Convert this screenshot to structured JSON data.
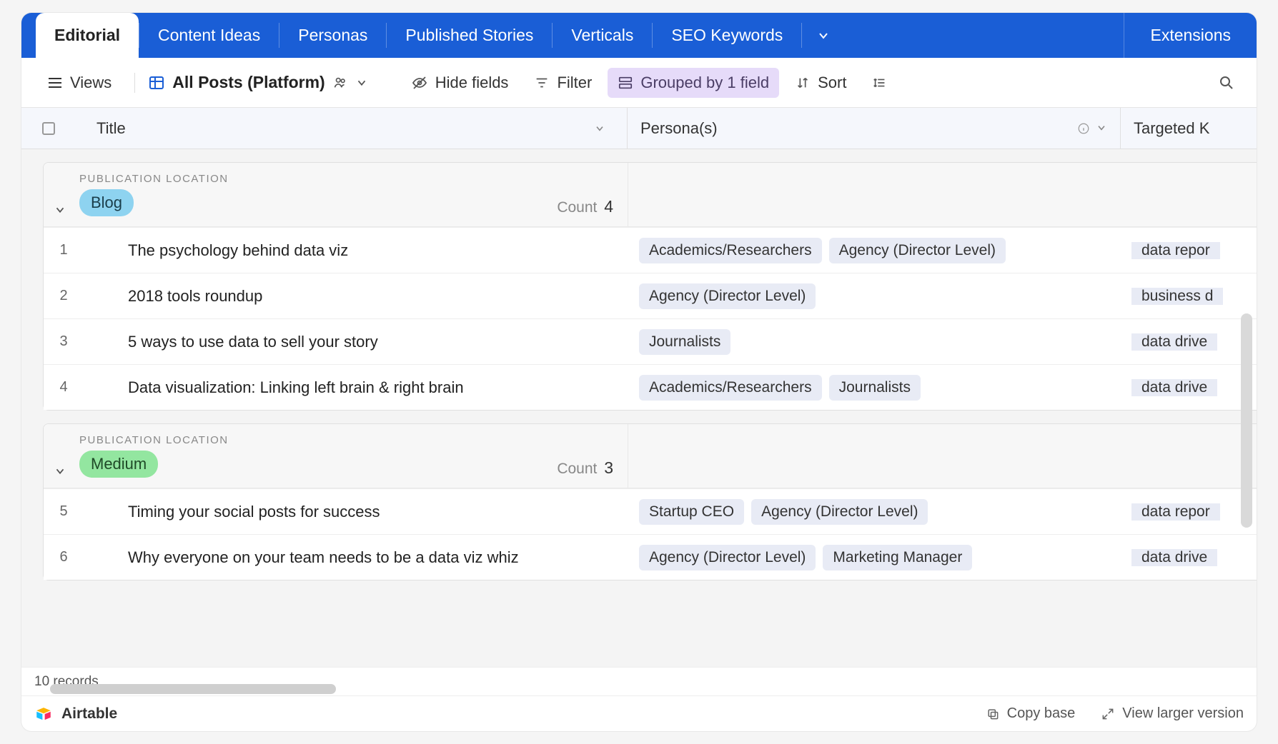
{
  "tabs": {
    "items": [
      "Editorial",
      "Content Ideas",
      "Personas",
      "Published Stories",
      "Verticals",
      "SEO Keywords"
    ],
    "active_index": 0,
    "extensions_label": "Extensions"
  },
  "toolbar": {
    "views_label": "Views",
    "view_name": "All Posts (Platform)",
    "hide_fields_label": "Hide fields",
    "filter_label": "Filter",
    "grouped_label": "Grouped by 1 field",
    "sort_label": "Sort"
  },
  "columns": {
    "title": "Title",
    "personas": "Persona(s)",
    "keywords": "Targeted K"
  },
  "group_label": "PUBLICATION LOCATION",
  "count_label": "Count",
  "groups": [
    {
      "name": "Blog",
      "pill_class": "pill-blog",
      "count": 4,
      "rows": [
        {
          "n": 1,
          "title": "The psychology behind data viz",
          "personas": [
            "Academics/Researchers",
            "Agency (Director Level)"
          ],
          "kw": "data repor"
        },
        {
          "n": 2,
          "title": "2018 tools roundup",
          "personas": [
            "Agency (Director Level)"
          ],
          "kw": "business d"
        },
        {
          "n": 3,
          "title": "5 ways to use data to sell your story",
          "personas": [
            "Journalists"
          ],
          "kw": "data drive"
        },
        {
          "n": 4,
          "title": "Data visualization: Linking left brain & right brain",
          "personas": [
            "Academics/Researchers",
            "Journalists"
          ],
          "kw": "data drive"
        }
      ]
    },
    {
      "name": "Medium",
      "pill_class": "pill-medium",
      "count": 3,
      "rows": [
        {
          "n": 5,
          "title": "Timing your social posts for success",
          "personas": [
            "Startup CEO",
            "Agency (Director Level)"
          ],
          "kw": "data repor"
        },
        {
          "n": 6,
          "title": "Why everyone on your team needs to be a data viz whiz",
          "personas": [
            "Agency (Director Level)",
            "Marketing Manager"
          ],
          "kw": "data drive"
        }
      ]
    }
  ],
  "footer": {
    "records_label": "10 records"
  },
  "brand": "Airtable",
  "bottom": {
    "copy_label": "Copy base",
    "larger_label": "View larger version"
  }
}
